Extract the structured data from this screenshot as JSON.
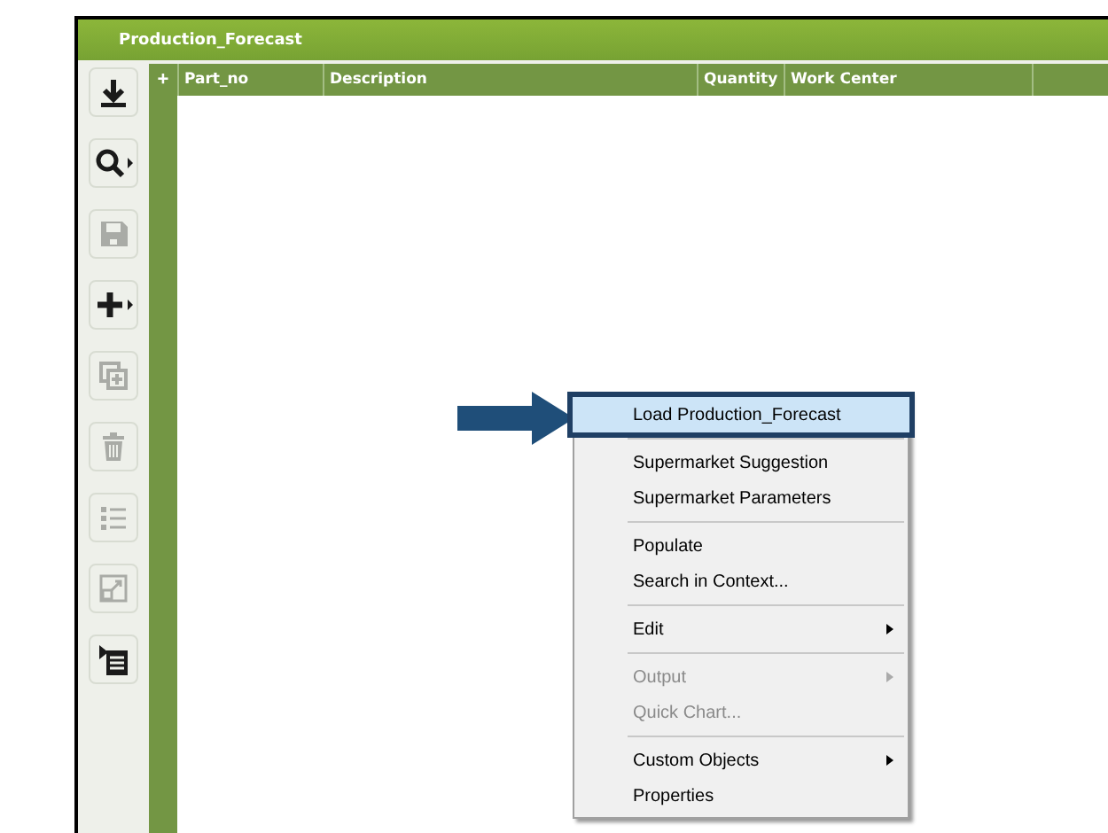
{
  "window": {
    "title": "Production_Forecast"
  },
  "toolbar": [
    {
      "kind": "download",
      "disabled": false,
      "has_dropdown": false
    },
    {
      "kind": "search",
      "disabled": false,
      "has_dropdown": true
    },
    {
      "kind": "save",
      "disabled": true,
      "has_dropdown": false
    },
    {
      "kind": "add",
      "disabled": false,
      "has_dropdown": true
    },
    {
      "kind": "copy",
      "disabled": true,
      "has_dropdown": false
    },
    {
      "kind": "delete",
      "disabled": true,
      "has_dropdown": false
    },
    {
      "kind": "list",
      "disabled": true,
      "has_dropdown": false
    },
    {
      "kind": "resize",
      "disabled": true,
      "has_dropdown": false
    },
    {
      "kind": "details",
      "disabled": false,
      "has_dropdown": false
    }
  ],
  "table": {
    "add_symbol": "+",
    "columns": [
      "Part_no",
      "Description",
      "Quantity",
      "Work Center"
    ]
  },
  "context_menu": {
    "groups": [
      [
        {
          "label": "Load Production_Forecast",
          "selected": true,
          "disabled": false,
          "submenu": false
        }
      ],
      [
        {
          "label": "Supermarket Suggestion",
          "selected": false,
          "disabled": false,
          "submenu": false
        },
        {
          "label": "Supermarket Parameters",
          "selected": false,
          "disabled": false,
          "submenu": false
        }
      ],
      [
        {
          "label": "Populate",
          "selected": false,
          "disabled": false,
          "submenu": false
        },
        {
          "label": "Search in Context...",
          "selected": false,
          "disabled": false,
          "submenu": false
        }
      ],
      [
        {
          "label": "Edit",
          "selected": false,
          "disabled": false,
          "submenu": true
        }
      ],
      [
        {
          "label": "Output",
          "selected": false,
          "disabled": true,
          "submenu": true
        },
        {
          "label": "Quick Chart...",
          "selected": false,
          "disabled": true,
          "submenu": false
        }
      ],
      [
        {
          "label": "Custom Objects",
          "selected": false,
          "disabled": false,
          "submenu": true
        },
        {
          "label": "Properties",
          "selected": false,
          "disabled": false,
          "submenu": false
        }
      ]
    ]
  }
}
